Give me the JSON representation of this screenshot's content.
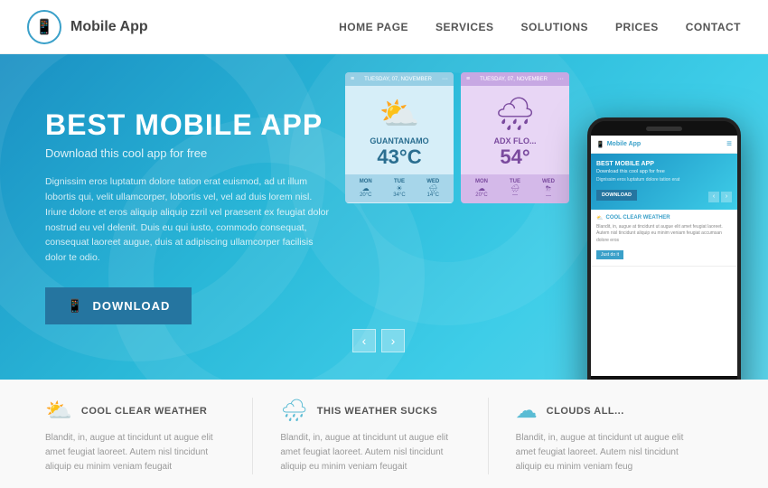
{
  "header": {
    "logo_label": "Mobile App",
    "nav": [
      {
        "label": "HOME PAGE",
        "id": "home"
      },
      {
        "label": "SERVICES",
        "id": "services"
      },
      {
        "label": "SOLUTIONS",
        "id": "solutions"
      },
      {
        "label": "PRICES",
        "id": "prices"
      },
      {
        "label": "CONTACT",
        "id": "contact"
      }
    ]
  },
  "hero": {
    "title": "BEST MOBILE APP",
    "subtitle": "Download this cool app for free",
    "description": "Dignissim eros luptatum dolore tation erat euismod, ad ut illum lobortis qui, velit ullamcorper, lobortis vel, vel ad duis lorem nisl. Iriure dolore et eros aliquip aliquip zzril vel praesent ex feugiat dolor nostrud eu vel delenit. Duis eu qui iusto, commodo consequat, consequat laoreet augue, duis at adipiscing ullamcorper facilisis dolor te odio.",
    "download_label": "DOWNLOAD"
  },
  "phone_cards": {
    "card1": {
      "date": "TUESDAY, 07, NOVEMBER",
      "city": "GUANTANAMO",
      "temp": "43°C",
      "days": [
        {
          "day": "MON",
          "temp": "20°C"
        },
        {
          "day": "TUE",
          "temp": "34°C"
        },
        {
          "day": "WED",
          "temp": "14°C"
        }
      ]
    },
    "card2": {
      "date": "TUESDAY, 07, NOVEMBER",
      "city": "ADX FLO...",
      "temp": "54°",
      "days": [
        {
          "day": "MON",
          "temp": "20°C"
        },
        {
          "day": "TUE",
          "temp": ""
        },
        {
          "day": "WED",
          "temp": ""
        }
      ]
    }
  },
  "big_phone": {
    "logo": "Mobile App",
    "hero_title": "BEST MOBILE APP",
    "hero_sub": "Download this cool app for free",
    "hero_desc": "Dignissim eros luptatum dolore tation erat",
    "download_label": "DOWNLOAD",
    "feature_title": "COOL CLEAR WEATHER",
    "feature_text": "Blandit, in, augue at tincidunt ut augue elit amet feugiat laoreet. Autem nisl tincidunt aliquip eu minim veniam feugiat accumsan dolore eros",
    "feature_btn": "Just do it"
  },
  "arrows": {
    "prev": "‹",
    "next": "›"
  },
  "features": [
    {
      "id": "cool-clear-weather",
      "title": "COOL CLEAR WEATHER",
      "description": "Blandit, in, augue at tincidunt ut augue elit amet feugiat laoreet. Autem nisl tincidunt aliquip eu minim veniam feugait"
    },
    {
      "id": "this-weather-sucks",
      "title": "THIS WEATHER SUCKS",
      "description": "Blandit, in, augue at tincidunt ut augue elit amet feugiat laoreet. Autem nisl tincidunt aliquip eu minim veniam feugait"
    },
    {
      "id": "clouds-all",
      "title": "CLOUDS ALL...",
      "description": "Blandit, in, augue at tincidunt ut augue elit amet feugiat laoreet. Autem nisl tincidunt aliquip eu minim veniam feug"
    }
  ]
}
